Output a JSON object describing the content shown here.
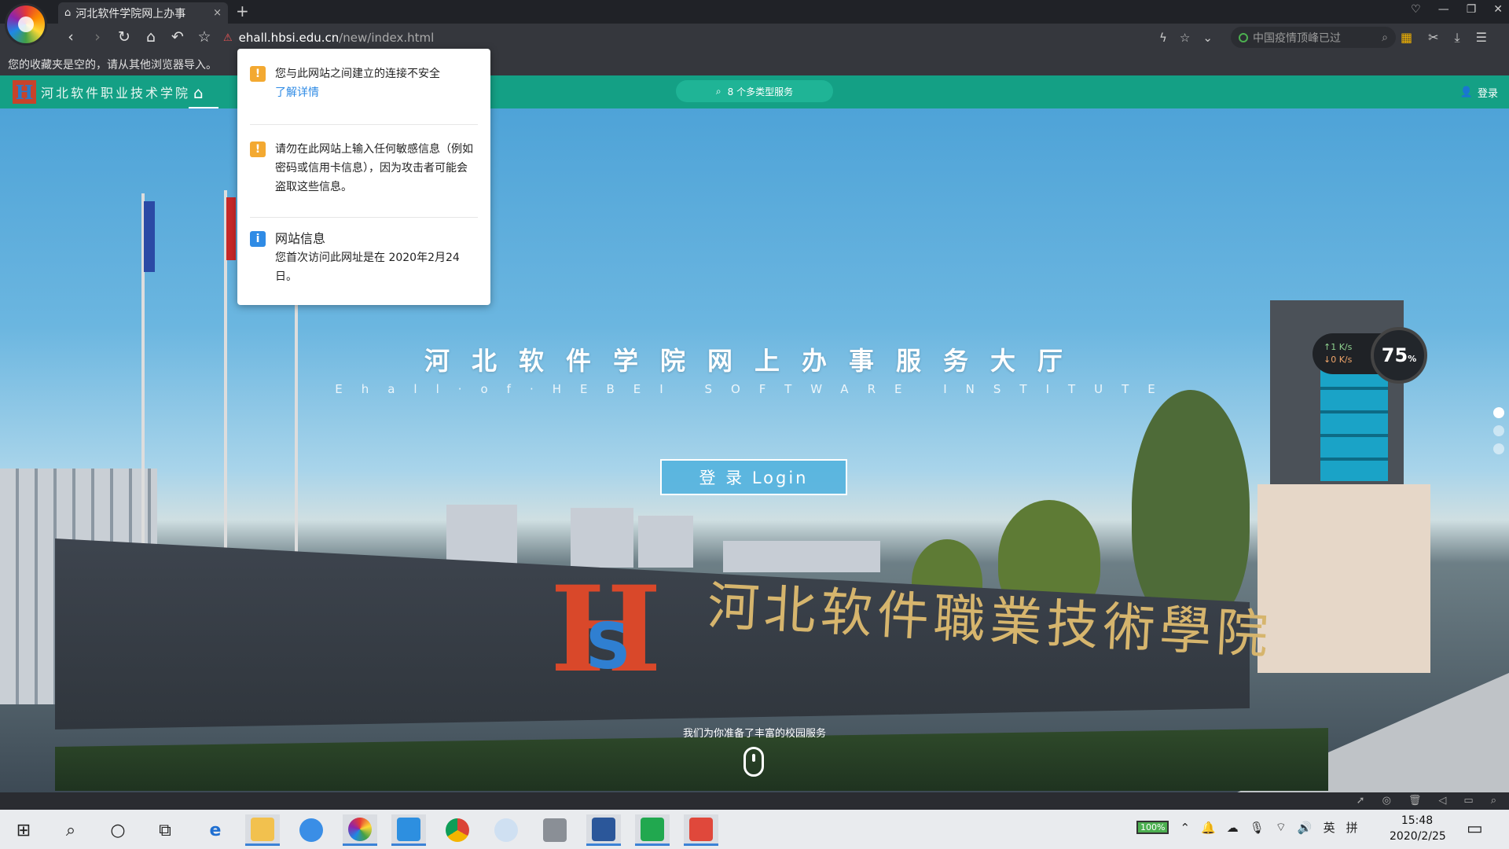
{
  "browser": {
    "tab_title": "河北软件学院网上办事",
    "tab_close": "×",
    "new_tab": "+",
    "address": {
      "host": "ehall.hbsi.edu.cn",
      "path": "/new/index.html"
    },
    "search_placeholder": "中国疫情顶峰已过",
    "bookmarks_notice": "您的收藏夹是空的，请从其他浏览器导入。"
  },
  "security_popup": {
    "insecure_title": "您与此网站之间建立的连接不安全",
    "learn_more": "了解详情",
    "sensitive_warning": "请勿在此网站上输入任何敏感信息（例如密码或信用卡信息），因为攻击者可能会盗取这些信息。",
    "site_info_title": "网站信息",
    "site_info_text": "您首次访问此网址是在 2020年2月24日。"
  },
  "site": {
    "logo_mark": "H",
    "logo_name": "河北软件职业技术学院",
    "service_search": "8 个多类型服务",
    "login_link": "登录",
    "hero_title": "河北软件学院网上办事服务大厅",
    "hero_subtitle": "Ehall·of·HEBEI SOFTWARE INSTITUTE",
    "login_button": "登 录  Login",
    "hint": "我们为你准备了丰富的校园服务",
    "sign_text": "河北软件職業技術學院"
  },
  "speed_widget": {
    "up": "↑1 K/s",
    "down": "↓0 K/s",
    "percent": "75",
    "percent_unit": "%"
  },
  "taskbar": {
    "battery": "100%",
    "ime_lang": "英",
    "ime_mode": "拼",
    "time": "15:48",
    "date": "2020/2/25"
  },
  "colors": {
    "header_green": "#14a085",
    "accent_blue": "#2f8be5",
    "warn_orange": "#f3a931"
  }
}
